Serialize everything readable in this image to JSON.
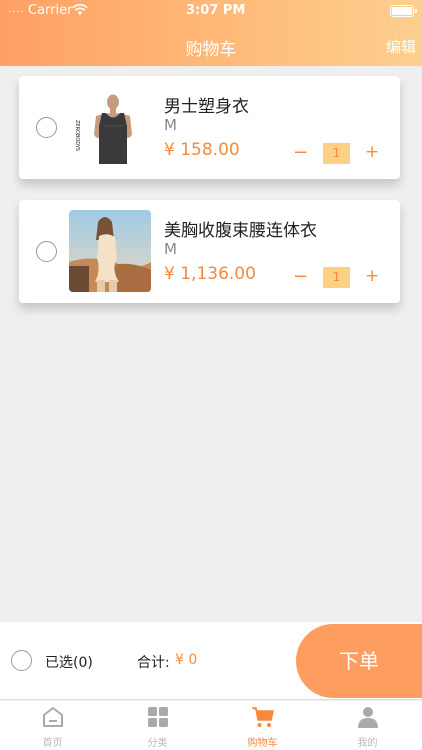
{
  "status_bar": {
    "dots": "....",
    "carrier": "Carrier",
    "time": "3:07 PM"
  },
  "nav": {
    "title": "购物车",
    "edit": "编辑"
  },
  "cart_items": [
    {
      "name": "男士塑身衣",
      "size": "M",
      "price": "¥ 158.00",
      "qty_minus": "−",
      "quantity": "1",
      "qty_plus": "+",
      "image_label": "ZEROBODYS"
    },
    {
      "name": "美胸收腹束腰连体衣",
      "size": "M",
      "price": "¥ 1,136.00",
      "qty_minus": "−",
      "quantity": "1",
      "qty_plus": "+"
    }
  ],
  "bottom": {
    "selected": "已选(0)",
    "total_label": "合计:",
    "total_value": "¥ 0",
    "order_button": "下单"
  },
  "tabs": [
    {
      "label": "首页",
      "icon": "home-icon",
      "active": false
    },
    {
      "label": "分类",
      "icon": "category-grid-icon",
      "active": false
    },
    {
      "label": "购物车",
      "icon": "cart-icon",
      "active": true
    },
    {
      "label": "我的",
      "icon": "user-icon",
      "active": false
    }
  ],
  "colors": {
    "accent": "#f5893d",
    "header_start": "#ffa066",
    "header_end": "#fccf8f",
    "order_button": "#fd9d60",
    "qty_bg": "#fcd183"
  }
}
